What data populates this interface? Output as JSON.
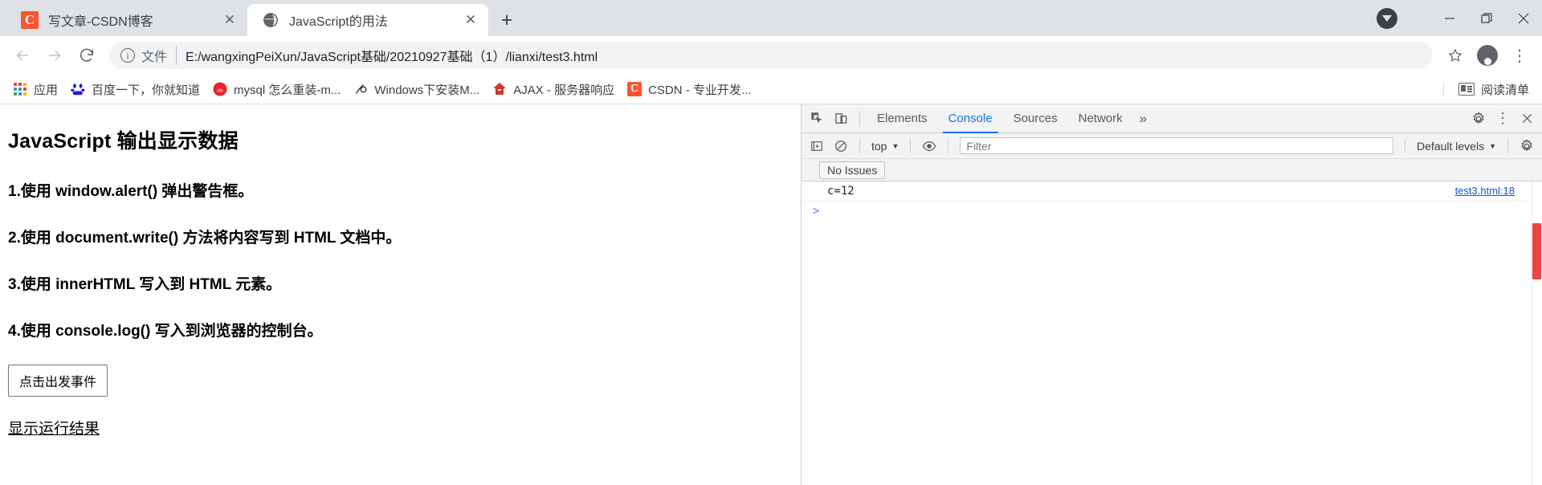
{
  "window": {
    "tabs": [
      {
        "title": "写文章-CSDN博客",
        "favicon": "csdn-icon",
        "active": false,
        "close_label": "✕"
      },
      {
        "title": "JavaScript的用法",
        "favicon": "globe-icon",
        "active": true,
        "close_label": "✕"
      }
    ],
    "new_tab_label": "+",
    "controls": {
      "download_indicator": "download-arrow",
      "minimize": "—",
      "maximize": "□",
      "close": "✕"
    }
  },
  "navbar": {
    "back": "back-arrow",
    "forward": "forward-arrow",
    "reload": "reload-arrow",
    "omnibox": {
      "info_glyph": "i",
      "scheme_label": "文件",
      "url": "E:/wangxingPeiXun/JavaScript基础/20210927基础（1）/lianxi/test3.html"
    },
    "bookmark_star": "star-icon",
    "profile": "profile-avatar",
    "menu": "⋮"
  },
  "bookmarks": {
    "items": [
      {
        "label": "应用",
        "icon": "apps-grid-icon"
      },
      {
        "label": "百度一下，你就知道",
        "icon": "baidu-icon"
      },
      {
        "label": "mysql 怎么重装-m...",
        "icon": "csdn-red-icon"
      },
      {
        "label": "Windows下安装M...",
        "icon": "script-icon"
      },
      {
        "label": "AJAX - 服务器响应",
        "icon": "runoob-icon"
      },
      {
        "label": "CSDN - 专业开发...",
        "icon": "csdn-icon"
      }
    ],
    "reading_list": {
      "label": "阅读清单",
      "icon": "reading-list-icon"
    }
  },
  "page": {
    "heading": "JavaScript 输出显示数据",
    "lines": [
      "1.使用 window.alert() 弹出警告框。",
      "2.使用 document.write() 方法将内容写到 HTML 文档中。",
      "3.使用 innerHTML 写入到 HTML 元素。",
      "4.使用 console.log() 写入到浏览器的控制台。"
    ],
    "button_label": "点击出发事件",
    "result_link": "显示运行结果"
  },
  "devtools": {
    "inspect_icon": "inspect-element-icon",
    "device_icon": "device-toolbar-icon",
    "tabs": [
      {
        "label": "Elements",
        "active": false
      },
      {
        "label": "Console",
        "active": true
      },
      {
        "label": "Sources",
        "active": false
      },
      {
        "label": "Network",
        "active": false
      }
    ],
    "overflow_label": "»",
    "settings_icon": "gear-icon",
    "kebab_icon": "⋮",
    "close_icon": "✕",
    "toolbar": {
      "clear_icon": "clear-console-icon",
      "no_blocking_icon": "no-entry-icon",
      "context": "top",
      "context_caret": "▼",
      "eye_icon": "live-expression-icon",
      "filter_placeholder": "Filter",
      "levels_label": "Default levels",
      "levels_caret": "▼",
      "settings_icon": "console-settings-gear"
    },
    "issues_label": "No Issues",
    "logs": [
      {
        "message": "c=12",
        "source": "test3.html:18"
      }
    ],
    "prompt": ">"
  }
}
